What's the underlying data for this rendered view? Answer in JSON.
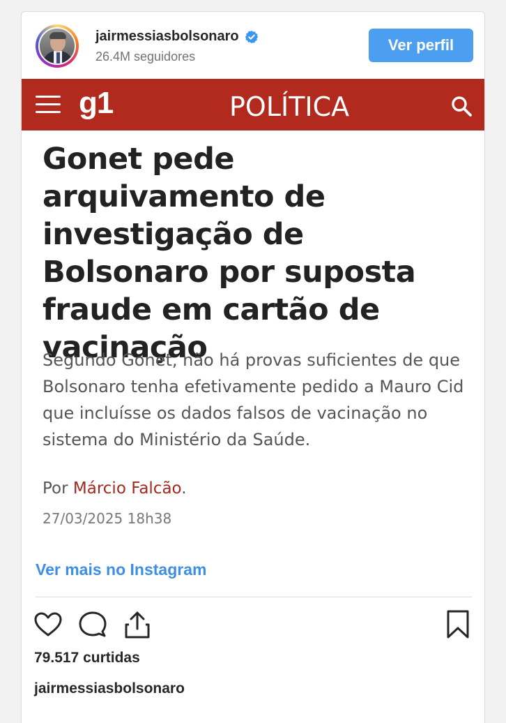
{
  "profile": {
    "username": "jairmessiasbolsonaro",
    "followers": "26.4M seguidores",
    "follow_button": "Ver perfil",
    "verified": true
  },
  "article": {
    "logo": "g1",
    "section": "POLÍTICA",
    "headline": "Gonet pede arquivamento de investigação de Bolsonaro por suposta fraude em cartão de vacinação",
    "lead": "Segundo Gonet, não há provas suficientes de que Bolsonaro tenha efetivamente pedido a Mauro Cid que incluísse os dados falsos de vacinação no sistema do Ministério da Saúde.",
    "byline_prefix": "Por",
    "author": "Márcio Falcão",
    "byline_suffix": ".",
    "date": "27/03/2025 18h38"
  },
  "footer": {
    "see_more": "Ver mais no Instagram",
    "likes": "79.517 curtidas",
    "caption_user": "jairmessiasbolsonaro"
  },
  "colors": {
    "g1_red": "#b12a1d",
    "button_blue": "#4c9ff0",
    "link_blue": "#3d8ee6",
    "author_red": "#a4281f"
  },
  "icons": [
    "verified-badge-icon",
    "menu-icon",
    "search-icon",
    "heart-icon",
    "comment-icon",
    "share-icon",
    "bookmark-icon"
  ]
}
